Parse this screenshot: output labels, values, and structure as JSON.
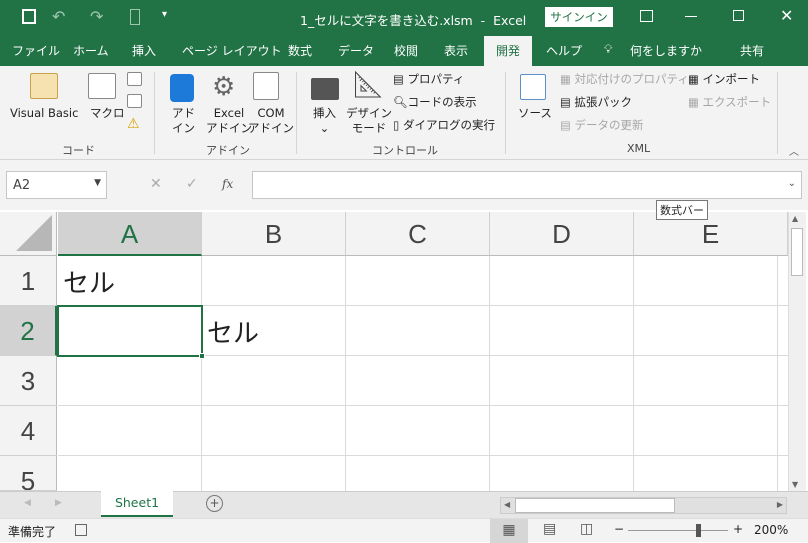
{
  "title_bar": {
    "title": "1_セルに文字を書き込む.xlsm  -  Excel",
    "signin": "サインイン",
    "accent": "#217346"
  },
  "tabs": [
    "ファイル",
    "ホーム",
    "挿入",
    "ページ レイアウト",
    "数式",
    "データ",
    "校閲",
    "表示",
    "開発",
    "ヘルプ"
  ],
  "tell_me": "何をしますか",
  "share": "共有",
  "ribbon": {
    "code": {
      "label": "コード",
      "visual_basic": "Visual Basic",
      "macro": "マクロ"
    },
    "addins": {
      "label": "アドイン",
      "addin1": "アド",
      "addin2": "イン",
      "excel1": "Excel",
      "excel2": "アドイン",
      "com1": "COM",
      "com2": "アドイン"
    },
    "controls": {
      "label": "コントロール",
      "insert": "挿入",
      "design1": "デザイン",
      "design2": "モード",
      "properties": "プロパティ",
      "view_code": "コードの表示",
      "run_dialog": "ダイアログの実行"
    },
    "xml": {
      "label": "XML",
      "source": "ソース",
      "map_props": "対応付けのプロパティ",
      "expansion": "拡張パック",
      "refresh": "データの更新",
      "import": "インポート",
      "export": "エクスポート"
    }
  },
  "formula_bar": {
    "name_box": "A2",
    "value": "",
    "fx": "fx",
    "tooltip": "数式バー"
  },
  "grid": {
    "columns": [
      "A",
      "B",
      "C",
      "D",
      "E"
    ],
    "rows": [
      "1",
      "2",
      "3",
      "4",
      "5"
    ],
    "cells": {
      "A1": "セル",
      "B2": "セル"
    },
    "selected": "A2"
  },
  "sheets": [
    "Sheet1"
  ],
  "status": {
    "ready": "準備完了",
    "zoom": "200%",
    "zoom_minus": "−",
    "zoom_plus": "+"
  }
}
